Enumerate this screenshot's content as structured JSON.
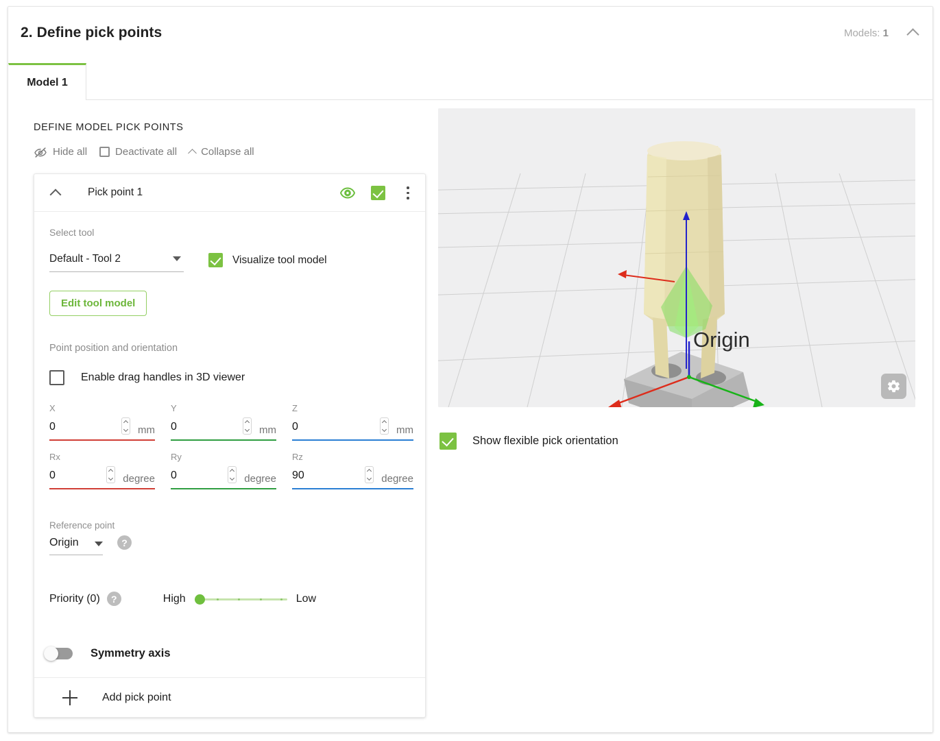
{
  "header": {
    "title": "2. Define pick points",
    "models_label": "Models:",
    "models_count": "1",
    "collapse_icon": "chevron-up-icon"
  },
  "tabs": [
    {
      "label": "Model 1",
      "active": true
    }
  ],
  "left_panel": {
    "section_title": "DEFINE MODEL PICK POINTS",
    "bulk_actions": [
      {
        "label": "Hide all",
        "icon": "eye-off-icon"
      },
      {
        "label": "Deactivate all",
        "icon": "checkbox-empty-icon"
      },
      {
        "label": "Collapse all",
        "icon": "chevron-up-icon"
      }
    ],
    "pick_point": {
      "title": "Pick point 1",
      "collapse_icon": "chevron-up-icon",
      "visibility_icon": "eye-icon",
      "active_checkbox_checked": true,
      "menu_icon": "kebab-menu-icon",
      "select_tool_label": "Select tool",
      "tool_value": "Default - Tool 2",
      "visualize_label": "Visualize tool model",
      "visualize_checked": true,
      "edit_tool_button": "Edit tool model",
      "position_label": "Point position and orientation",
      "drag_handles_label": "Enable drag handles in 3D viewer",
      "drag_handles_checked": false,
      "position_fields": [
        {
          "label": "X",
          "value": "0",
          "unit": "mm",
          "axis_color": "#d03e35"
        },
        {
          "label": "Y",
          "value": "0",
          "unit": "mm",
          "axis_color": "#2f9e41"
        },
        {
          "label": "Z",
          "value": "0",
          "unit": "mm",
          "axis_color": "#2a7fd4"
        }
      ],
      "rotation_fields": [
        {
          "label": "Rx",
          "value": "0",
          "unit": "degree",
          "axis_color": "#d03e35"
        },
        {
          "label": "Ry",
          "value": "0",
          "unit": "degree",
          "axis_color": "#2f9e41"
        },
        {
          "label": "Rz",
          "value": "90",
          "unit": "degree",
          "axis_color": "#2a7fd4"
        }
      ],
      "reference_point_label": "Reference point",
      "reference_point_value": "Origin",
      "reference_help_icon": "help-icon",
      "priority_label": "Priority (0)",
      "priority_help_icon": "help-icon",
      "priority_high_label": "High",
      "priority_low_label": "Low",
      "priority_value": 0,
      "symmetry_label": "Symmetry axis",
      "symmetry_enabled": false
    },
    "add_pick_point_label": "Add pick point"
  },
  "viewer": {
    "origin_label": "Origin",
    "settings_icon": "gear-icon",
    "background_color": "#efeff0",
    "axis_colors": {
      "x": "#dd2c1b",
      "y": "#18b318",
      "z": "#2222cc"
    },
    "model_color": "#e6ddb0",
    "part_color": "#b8b8b8",
    "cone_color": "#88e06a"
  },
  "right_panel": {
    "flexible_pick_label": "Show flexible pick orientation",
    "flexible_pick_checked": true
  },
  "theme": {
    "accent_green": "#7CC242",
    "accent_green_dark": "#6cb63a"
  }
}
